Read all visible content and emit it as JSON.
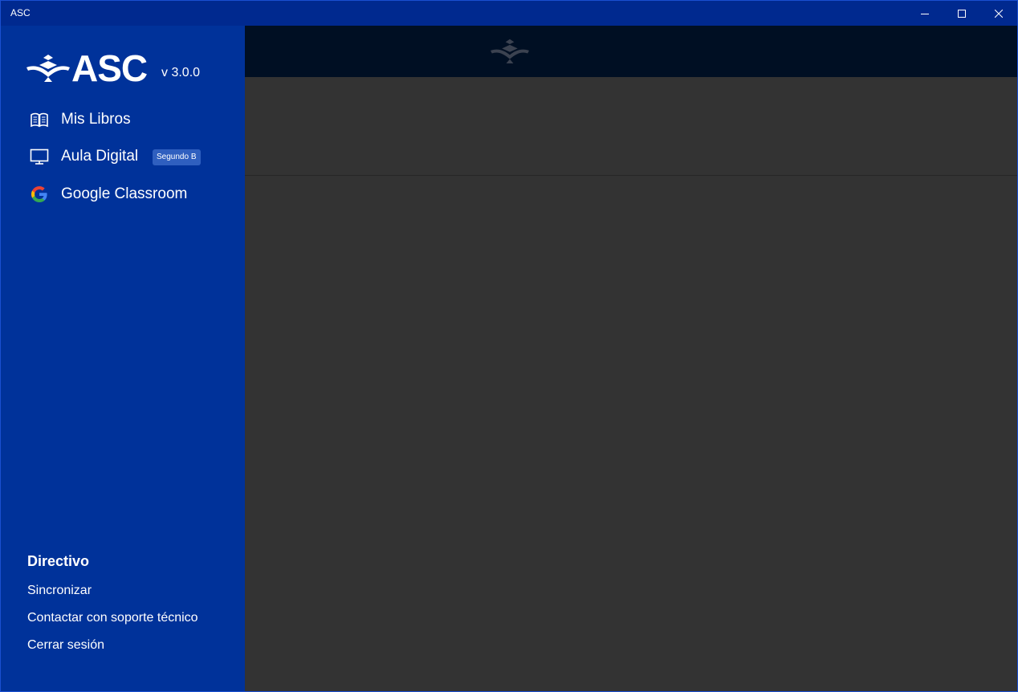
{
  "window": {
    "title": "ASC",
    "controls": [
      "minimize-icon",
      "maximize-icon",
      "close-icon"
    ]
  },
  "sidebar": {
    "logo_text": "ASC",
    "version": "v 3.0.0",
    "nav": [
      {
        "label": "Mis Libros",
        "icon": "book-icon"
      },
      {
        "label": "Aula Digital",
        "icon": "monitor-icon",
        "badge": "Segundo B"
      },
      {
        "label": "Google Classroom",
        "icon": "google-icon"
      }
    ],
    "role": "Directivo",
    "links": [
      "Sincronizar",
      "Contactar con soporte técnico",
      "Cerrar sesión"
    ]
  },
  "colors": {
    "titlebar": "#00298f",
    "sidebar": "#00329a",
    "header": "#000f23",
    "content": "#333333",
    "badge": "#2f5fbf",
    "google_blue": "#4285f4",
    "google_red": "#ea4335",
    "google_yellow": "#fbbc05",
    "google_green": "#34a853"
  }
}
